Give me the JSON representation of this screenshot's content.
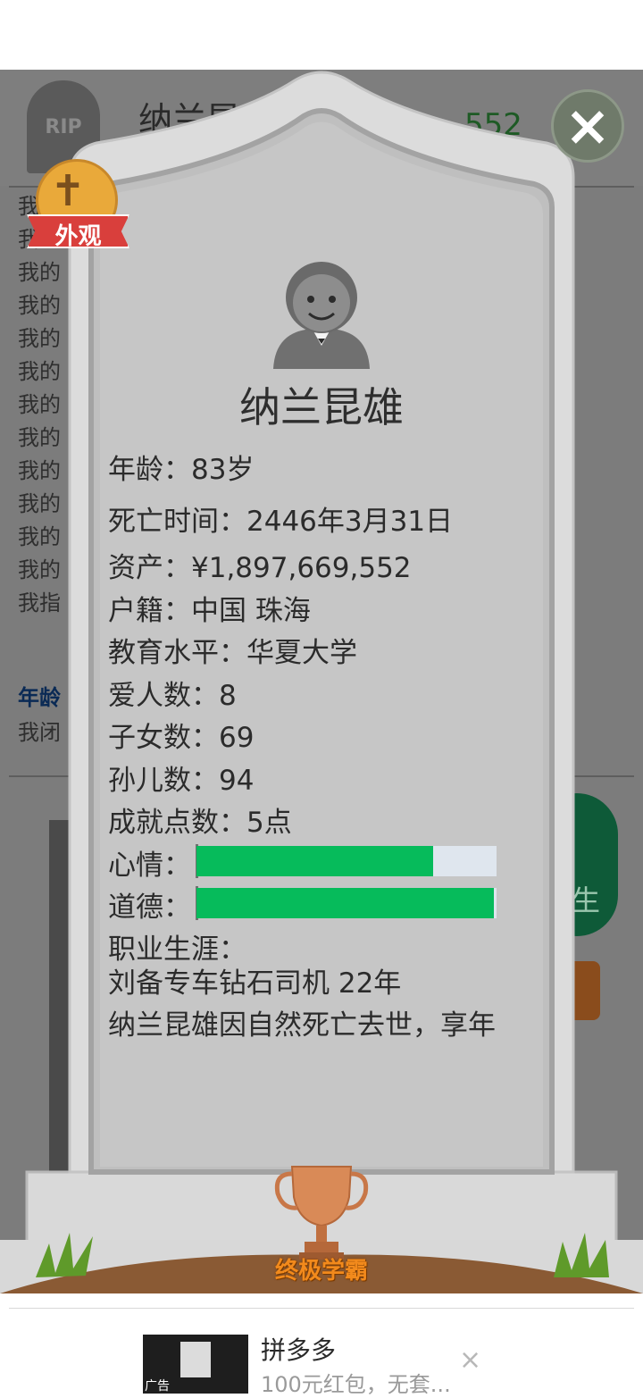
{
  "background": {
    "rip_label": "RIP",
    "name_partial": "纳兰昆",
    "money_partial": "552",
    "list_items": [
      "我",
      "我",
      "我的",
      "我的",
      "我的",
      "我的",
      "我的",
      "我的",
      "我的",
      "我的",
      "我的",
      "我的",
      "我指"
    ],
    "age_label": "年龄",
    "age_text": "我闭",
    "green_button_partial": "生"
  },
  "close_icon": "×",
  "badge": {
    "cross_icon": "✝",
    "label": "外观"
  },
  "tombstone": {
    "name": "纳兰昆雄",
    "rows": [
      {
        "label": "年龄：",
        "value": "83岁"
      },
      {
        "label": "死亡时间：",
        "value": "2446年3月31日"
      },
      {
        "label": "资产：",
        "value": "¥1,897,669,552"
      },
      {
        "label": "户籍：",
        "value": "中国 珠海"
      },
      {
        "label": "教育水平：",
        "value": "华夏大学"
      },
      {
        "label": "爱人数：",
        "value": "8"
      },
      {
        "label": "子女数：",
        "value": "69"
      },
      {
        "label": "孙儿数：",
        "value": "94"
      },
      {
        "label": "成就点数：",
        "value": "5点"
      }
    ],
    "mood_label": "心情：",
    "mood_fraction": 0.79,
    "morality_label": "道德：",
    "morality_fraction": 0.99,
    "career_label": "职业生涯：",
    "career_value": "刘备专车钻石司机 22年",
    "career_desc": "纳兰昆雄因自然死亡去世，享年"
  },
  "trophy": {
    "label": "终极学霸"
  },
  "ad": {
    "title": "拼多多",
    "desc": "100元红包，无套...",
    "tag": "广告",
    "close": "×"
  }
}
